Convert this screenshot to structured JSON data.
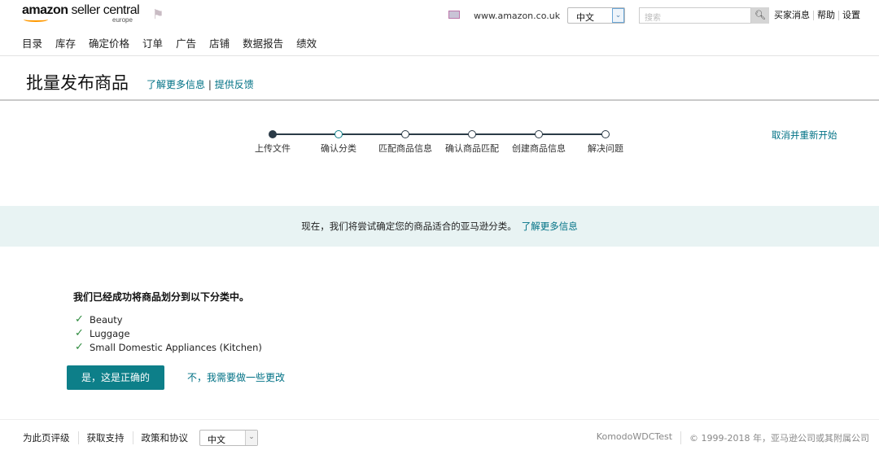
{
  "header": {
    "logo": "amazon seller central",
    "logo_sub": "europe",
    "flag_icon": "flag-icon",
    "marketplace_flag": "uk-flag-icon",
    "marketplace": "www.amazon.co.uk",
    "language": "中文",
    "search_placeholder": "搜索",
    "links": [
      "买家消息",
      "帮助",
      "设置"
    ]
  },
  "nav": [
    "目录",
    "库存",
    "确定价格",
    "订单",
    "广告",
    "店铺",
    "数据报告",
    "绩效"
  ],
  "page": {
    "title": "批量发布商品",
    "learn_more": "了解更多信息",
    "feedback": "提供反馈",
    "separator": "|"
  },
  "stepper": {
    "current_step": 2,
    "steps": [
      "上传文件",
      "确认分类",
      "匹配商品信息",
      "确认商品匹配",
      "创建商品信息",
      "解决问题"
    ],
    "cancel": "取消并重新开始"
  },
  "banner": {
    "text": "现在，我们将尝试确定您的商品适合的亚马逊分类。",
    "link": "了解更多信息"
  },
  "result": {
    "heading": "我们已经成功将商品划分到以下分类中。",
    "categories": [
      "Beauty",
      "Luggage",
      "Small Domestic Appliances (Kitchen)"
    ],
    "confirm": "是，这是正确的",
    "reject": "不，我需要做一些更改"
  },
  "footer": {
    "links": [
      "为此页评级",
      "获取支持",
      "政策和协议"
    ],
    "language": "中文",
    "user": "KomodoWDCTest",
    "copyright": "© 1999-2018 年，亚马逊公司或其附属公司"
  },
  "colors": {
    "accent": "#0d7f89",
    "link": "#007185",
    "banner_bg": "#e8f3f3",
    "check": "#2e8b3e"
  }
}
